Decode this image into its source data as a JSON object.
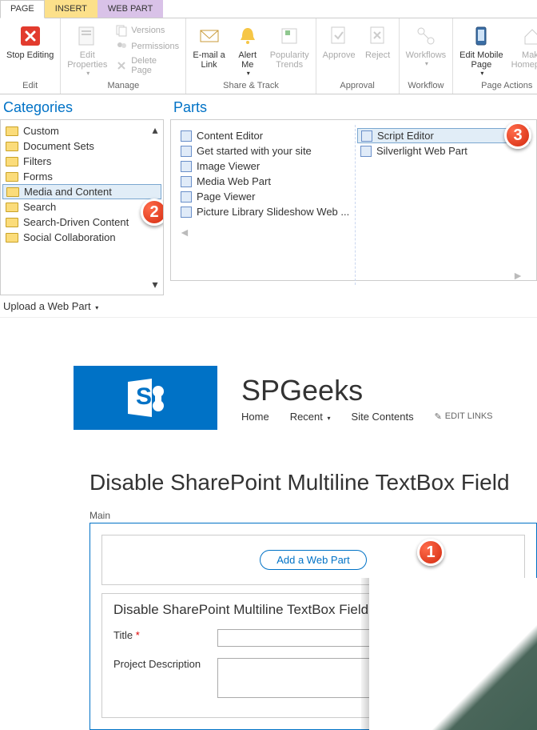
{
  "ribbon": {
    "tabs": {
      "page": "PAGE",
      "insert": "INSERT",
      "webpart": "WEB PART"
    },
    "groups": {
      "edit": {
        "label": "Edit",
        "stopEditing": "Stop Editing"
      },
      "manage": {
        "label": "Manage",
        "editProperties": "Edit\nProperties",
        "versions": "Versions",
        "permissions": "Permissions",
        "deletePage": "Delete Page"
      },
      "shareTrack": {
        "label": "Share & Track",
        "emailLink": "E-mail a\nLink",
        "alertMe": "Alert\nMe",
        "popularityTrends": "Popularity\nTrends"
      },
      "approval": {
        "label": "Approval",
        "approve": "Approve",
        "reject": "Reject"
      },
      "workflow": {
        "label": "Workflow",
        "workflows": "Workflows"
      },
      "pageActions": {
        "label": "Page Actions",
        "editMobilePage": "Edit Mobile\nPage",
        "makeHomepage": "Make\nHomepage"
      }
    }
  },
  "picker": {
    "categoriesHeader": "Categories",
    "partsHeader": "Parts",
    "categories": [
      "Custom",
      "Document Sets",
      "Filters",
      "Forms",
      "Media and Content",
      "Search",
      "Search-Driven Content",
      "Social Collaboration"
    ],
    "selectedCategoryIndex": 4,
    "partsLeft": [
      "Content Editor",
      "Get started with your site",
      "Image Viewer",
      "Media Web Part",
      "Page Viewer",
      "Picture Library Slideshow Web ..."
    ],
    "partsRight": [
      "Script Editor",
      "Silverlight Web Part"
    ],
    "selectedPartRightIndex": 0,
    "uploadLink": "Upload a Web Part"
  },
  "badges": {
    "one": "1",
    "two": "2",
    "three": "3"
  },
  "site": {
    "title": "SPGeeks",
    "nav": {
      "home": "Home",
      "recent": "Recent",
      "siteContents": "Site Contents",
      "editLinks": "EDIT LINKS"
    }
  },
  "page": {
    "heading": "Disable SharePoint Multiline TextBox Field",
    "zoneLabel": "Main",
    "addWebPart": "Add a Web Part",
    "formTitle": "Disable SharePoint Multiline TextBox Field",
    "fields": {
      "title": {
        "label": "Title",
        "value": ""
      },
      "description": {
        "label": "Project Description",
        "value": ""
      }
    }
  }
}
